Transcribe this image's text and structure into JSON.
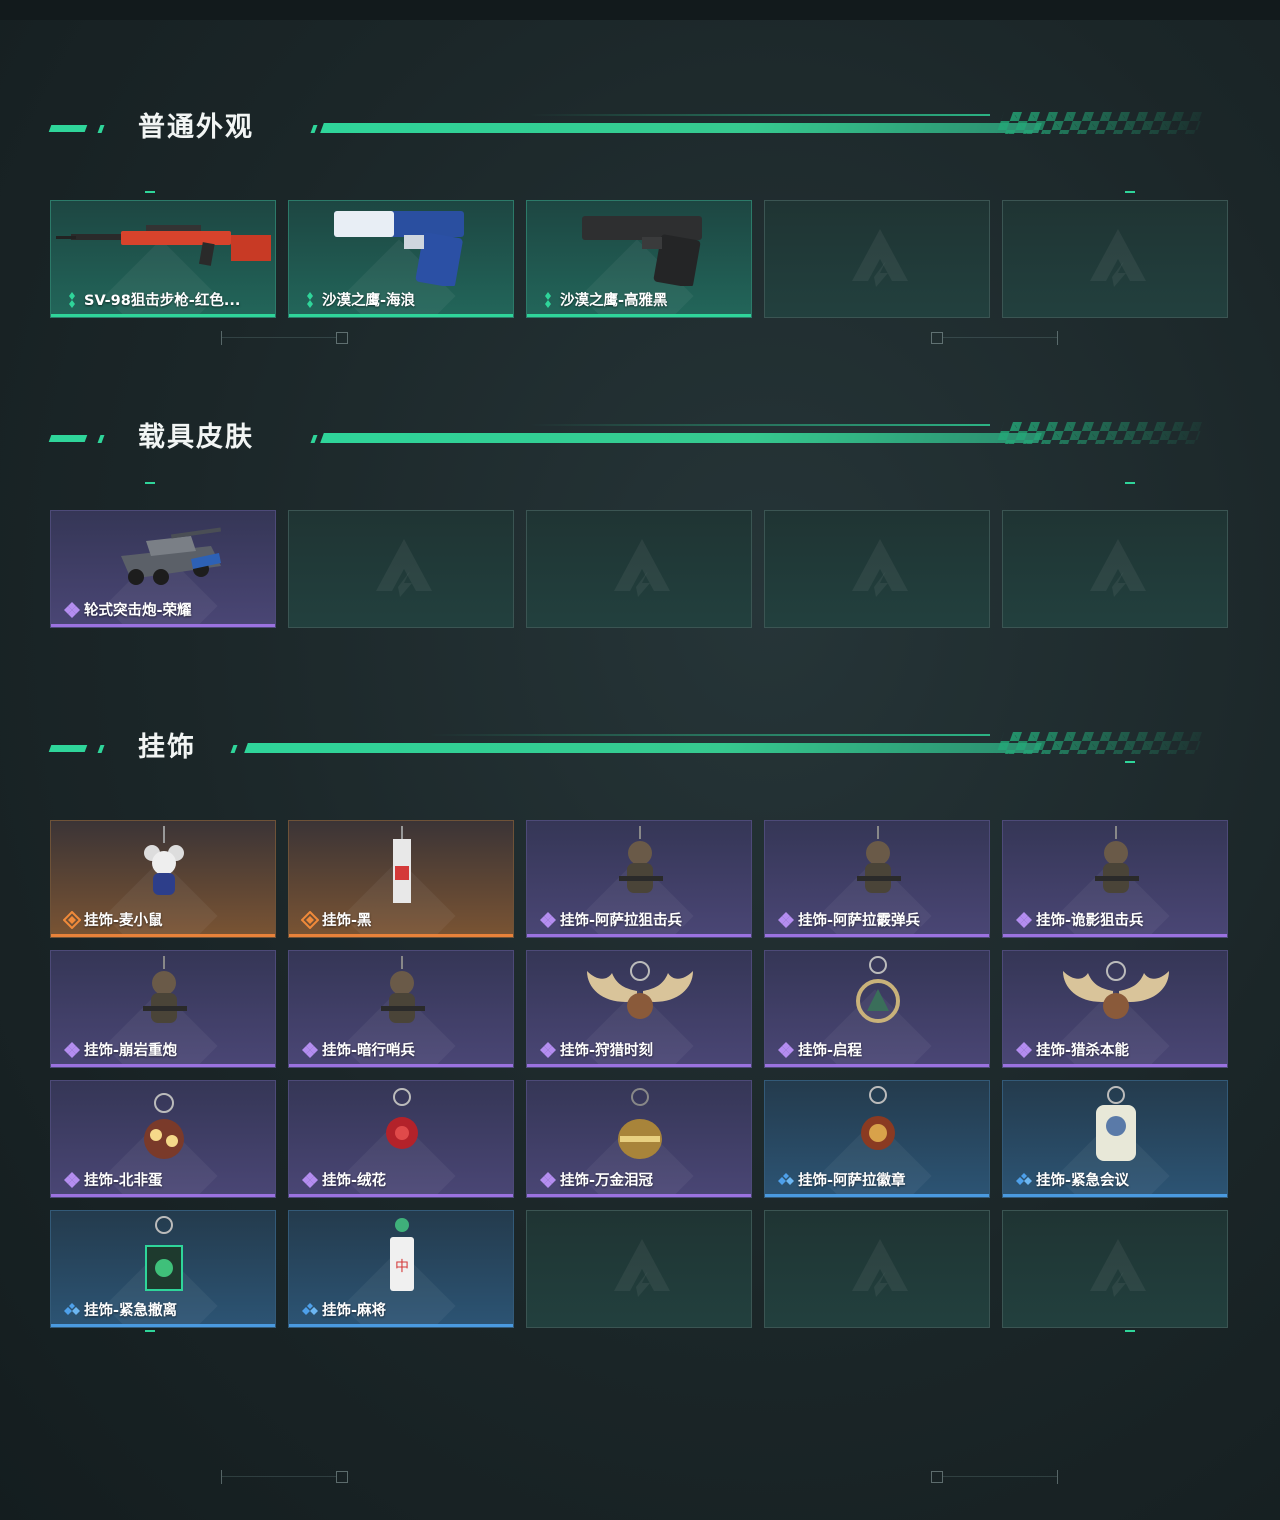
{
  "sections": [
    {
      "title": "普通外观",
      "items": [
        {
          "label": "SV-98狙击步枪-红色...",
          "rarity": "green",
          "icon": "sniper-rifle-icon"
        },
        {
          "label": "沙漠之鹰-海浪",
          "rarity": "green",
          "icon": "pistol-blue-icon"
        },
        {
          "label": "沙漠之鹰-高雅黑",
          "rarity": "green",
          "icon": "pistol-black-icon"
        },
        {
          "label": "",
          "rarity": "empty"
        },
        {
          "label": "",
          "rarity": "empty"
        }
      ]
    },
    {
      "title": "载具皮肤",
      "items": [
        {
          "label": "轮式突击炮-荣耀",
          "rarity": "purple",
          "icon": "armored-vehicle-icon"
        },
        {
          "label": "",
          "rarity": "empty"
        },
        {
          "label": "",
          "rarity": "empty"
        },
        {
          "label": "",
          "rarity": "empty"
        },
        {
          "label": "",
          "rarity": "empty"
        }
      ]
    },
    {
      "title": "挂饰",
      "items": [
        {
          "label": "挂饰-麦小鼠",
          "rarity": "orange",
          "icon": "mouse-charm-icon"
        },
        {
          "label": "挂饰-黑",
          "rarity": "orange",
          "icon": "tag-charm-icon"
        },
        {
          "label": "挂饰-阿萨拉狙击兵",
          "rarity": "purple",
          "icon": "soldier-charm-icon"
        },
        {
          "label": "挂饰-阿萨拉霰弹兵",
          "rarity": "purple",
          "icon": "soldier-charm-icon"
        },
        {
          "label": "挂饰-诡影狙击兵",
          "rarity": "purple",
          "icon": "soldier-charm-icon"
        },
        {
          "label": "挂饰-崩岩重炮",
          "rarity": "purple",
          "icon": "soldier-charm-icon"
        },
        {
          "label": "挂饰-暗行哨兵",
          "rarity": "purple",
          "icon": "soldier-charm-icon"
        },
        {
          "label": "挂饰-狩猎时刻",
          "rarity": "purple",
          "icon": "antler-charm-icon"
        },
        {
          "label": "挂饰-启程",
          "rarity": "purple",
          "icon": "medal-charm-icon"
        },
        {
          "label": "挂饰-猎杀本能",
          "rarity": "purple",
          "icon": "antler-charm-icon"
        },
        {
          "label": "挂饰-北非蛋",
          "rarity": "purple",
          "icon": "food-charm-icon"
        },
        {
          "label": "挂饰-绒花",
          "rarity": "purple",
          "icon": "flower-charm-icon"
        },
        {
          "label": "挂饰-万金泪冠",
          "rarity": "purple",
          "icon": "crown-charm-icon"
        },
        {
          "label": "挂饰-阿萨拉徽章",
          "rarity": "blue",
          "icon": "badge-charm-icon"
        },
        {
          "label": "挂饰-紧急会议",
          "rarity": "blue",
          "icon": "acrylic-charm-icon"
        },
        {
          "label": "挂饰-紧急撤离",
          "rarity": "blue",
          "icon": "box-charm-icon"
        },
        {
          "label": "挂饰-麻将",
          "rarity": "blue",
          "icon": "mahjong-charm-icon"
        },
        {
          "label": "",
          "rarity": "empty"
        },
        {
          "label": "",
          "rarity": "empty"
        },
        {
          "label": "",
          "rarity": "empty"
        }
      ]
    }
  ],
  "colors": {
    "accent_green": "#2fd59a",
    "rarity_green": "#2fd59a",
    "rarity_purple": "#9b72e0",
    "rarity_orange": "#e8823a",
    "rarity_blue": "#4a9ae0"
  }
}
